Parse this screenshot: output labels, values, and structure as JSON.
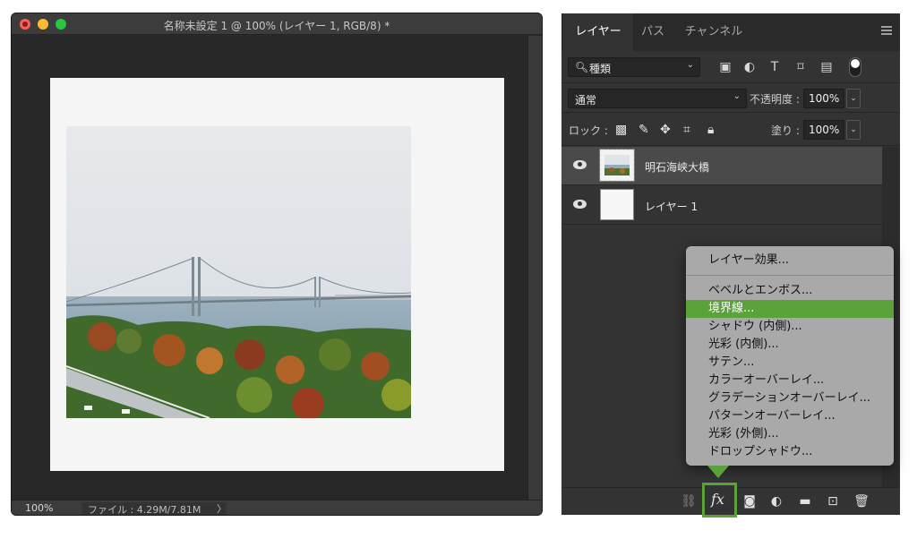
{
  "document": {
    "title": "名称未設定 1 @ 100% (レイヤー 1, RGB/8) *",
    "status_zoom": "100%",
    "status_file": "ファイル : 4.29M/7.81M",
    "status_arrow": "〉"
  },
  "panel": {
    "tabs": [
      "レイヤー",
      "パス",
      "チャンネル"
    ],
    "filter": {
      "icon": "search-icon",
      "label": "種類",
      "caret": "⌄"
    },
    "blend_mode": "通常",
    "opacity_label": "不透明度 :",
    "opacity_value": "100%",
    "lock_label": "ロック :",
    "fill_label": "塗り :",
    "fill_value": "100%",
    "layers": [
      {
        "name": "明石海峡大橋",
        "selected": true
      },
      {
        "name": "レイヤー 1",
        "selected": false
      }
    ]
  },
  "fx_menu": {
    "items": [
      "レイヤー効果...",
      "ベベルとエンボス...",
      "境界線...",
      "シャドウ (内側)...",
      "光彩 (内側)...",
      "サテン...",
      "カラーオーバーレイ...",
      "グラデーションオーバーレイ...",
      "パターンオーバーレイ...",
      "光彩 (外側)...",
      "ドロップシャドウ..."
    ],
    "highlighted": "境界線..."
  },
  "toolbar": {
    "fx_label": "fx"
  },
  "colors": {
    "accent_green": "#5ba23b",
    "panel_bg": "#333333",
    "menu_bg": "#a9a9a9"
  }
}
